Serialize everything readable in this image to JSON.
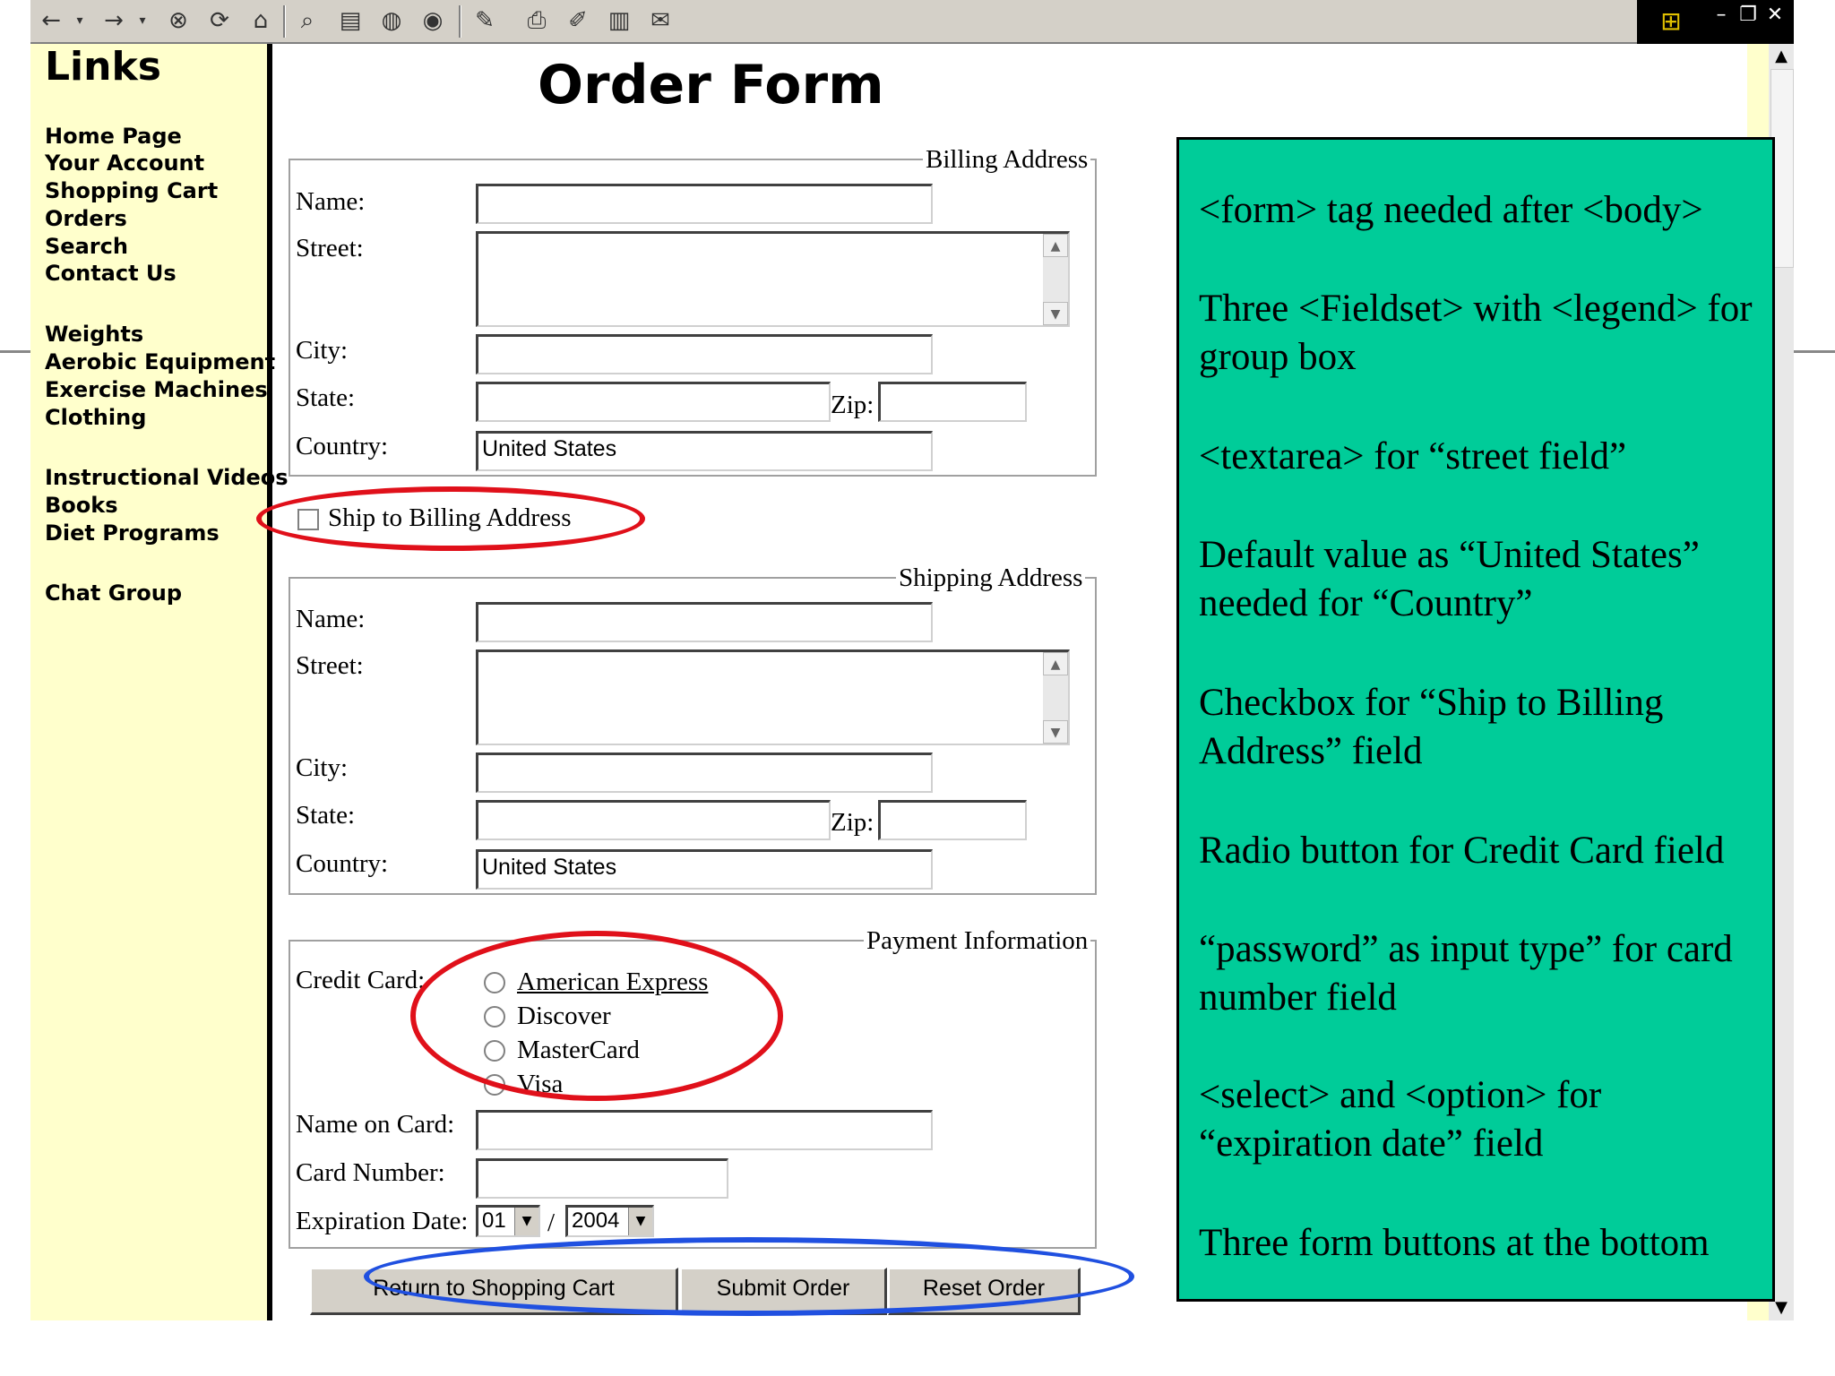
{
  "browser": {
    "toolbar_icons": [
      "back-arrow-icon",
      "dropdown-arrow-icon",
      "forward-arrow-icon",
      "dropdown-arrow-icon",
      "stop-icon",
      "refresh-icon",
      "home-icon",
      "search-icon",
      "favorites-icon",
      "history-icon",
      "media-icon",
      "edit-icon",
      "print-icon",
      "edit-page-icon",
      "document-icon",
      "messenger-icon"
    ],
    "window_controls": {
      "minimize": "–",
      "restore": "❐",
      "close": "✕"
    }
  },
  "sidebar": {
    "title": "Links",
    "groups": [
      [
        "Home Page",
        "Your Account",
        "Shopping Cart",
        "Orders",
        "Search",
        "Contact Us"
      ],
      [
        "Weights",
        "Aerobic Equipment",
        "Exercise Machines",
        "Clothing"
      ],
      [
        "Instructional Videos",
        "Books",
        "Diet Programs"
      ],
      [
        "Chat Group"
      ]
    ]
  },
  "form": {
    "title": "Order Form",
    "billing": {
      "legend": "Billing Address",
      "name_label": "Name:",
      "street_label": "Street:",
      "city_label": "City:",
      "state_label": "State:",
      "zip_label": "Zip:",
      "country_label": "Country:",
      "country_value": "United States"
    },
    "ship_to_billing_label": "Ship to Billing Address",
    "shipping": {
      "legend": "Shipping Address",
      "name_label": "Name:",
      "street_label": "Street:",
      "city_label": "City:",
      "state_label": "State:",
      "zip_label": "Zip:",
      "country_label": "Country:",
      "country_value": "United States"
    },
    "payment": {
      "legend": "Payment Information",
      "credit_card_label": "Credit Card:",
      "card_options": [
        "American Express",
        "Discover",
        "MasterCard",
        "Visa"
      ],
      "name_on_card_label": "Name on Card:",
      "card_number_label": "Card Number:",
      "expiration_label": "Expiration Date:",
      "exp_month": "01",
      "exp_separator": "/",
      "exp_year": "2004"
    },
    "buttons": {
      "return": "Return to Shopping Cart",
      "submit": "Submit Order",
      "reset": "Reset Order"
    }
  },
  "notes": [
    "<form> tag needed after <body>",
    "Three <Fieldset> with <legend> for group box",
    "<textarea> for “street field”",
    "Default value as “United States” needed for “Country”",
    "Checkbox for “Ship to Billing Address” field",
    "Radio button for Credit Card field",
    "“password” as input type” for card number field",
    "<select> and <option> for “expiration date” field",
    "Three form buttons at the bottom"
  ],
  "colors": {
    "sidebar_bg": "#ffffcc",
    "notes_bg": "#00cc99",
    "oval_red": "#e0101a",
    "oval_blue": "#2050e0"
  }
}
